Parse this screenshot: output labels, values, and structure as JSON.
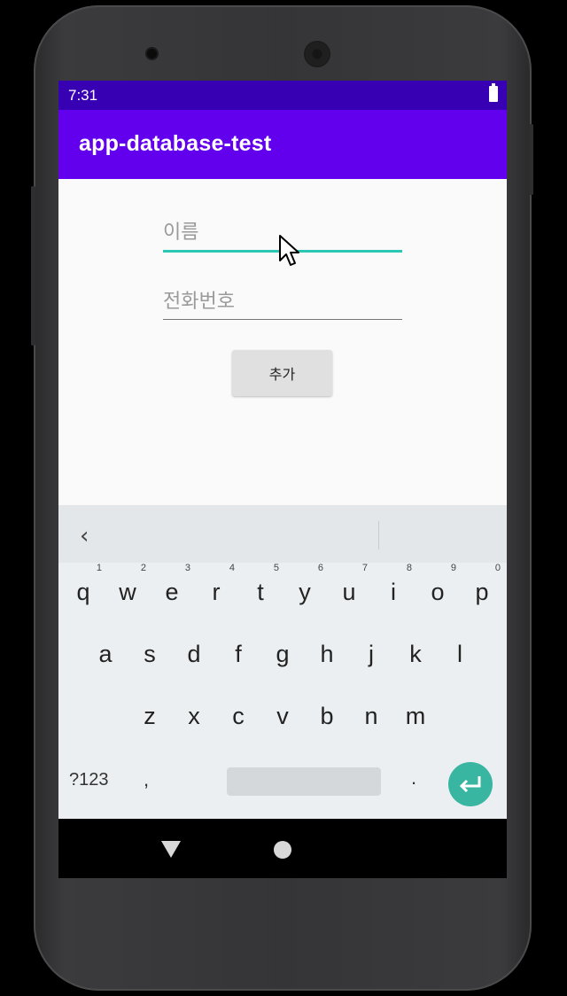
{
  "status_bar": {
    "time": "7:31",
    "battery_icon": "battery-full-icon"
  },
  "app_bar": {
    "title": "app-database-test",
    "color": "#6200ee",
    "status_color": "#3700b3"
  },
  "form": {
    "name_placeholder": "이름",
    "phone_placeholder": "전화번호",
    "add_button_label": "추가",
    "accent_color": "#2bc7b3"
  },
  "keyboard": {
    "suggestion_back": "‹",
    "row1": [
      {
        "ch": "q",
        "hint": "1"
      },
      {
        "ch": "w",
        "hint": "2"
      },
      {
        "ch": "e",
        "hint": "3"
      },
      {
        "ch": "r",
        "hint": "4"
      },
      {
        "ch": "t",
        "hint": "5"
      },
      {
        "ch": "y",
        "hint": "6"
      },
      {
        "ch": "u",
        "hint": "7"
      },
      {
        "ch": "i",
        "hint": "8"
      },
      {
        "ch": "o",
        "hint": "9"
      },
      {
        "ch": "p",
        "hint": "0"
      }
    ],
    "row2": [
      "a",
      "s",
      "d",
      "f",
      "g",
      "h",
      "j",
      "k",
      "l"
    ],
    "row3": [
      "z",
      "x",
      "c",
      "v",
      "b",
      "n",
      "m"
    ],
    "symbols_label": "?123",
    "comma_label": ",",
    "period_label": ".",
    "enter_icon": "enter-arrow-icon",
    "enter_color": "#38b6a2"
  },
  "nav_bar": {
    "back_icon": "nav-back-icon",
    "home_icon": "nav-home-icon"
  }
}
